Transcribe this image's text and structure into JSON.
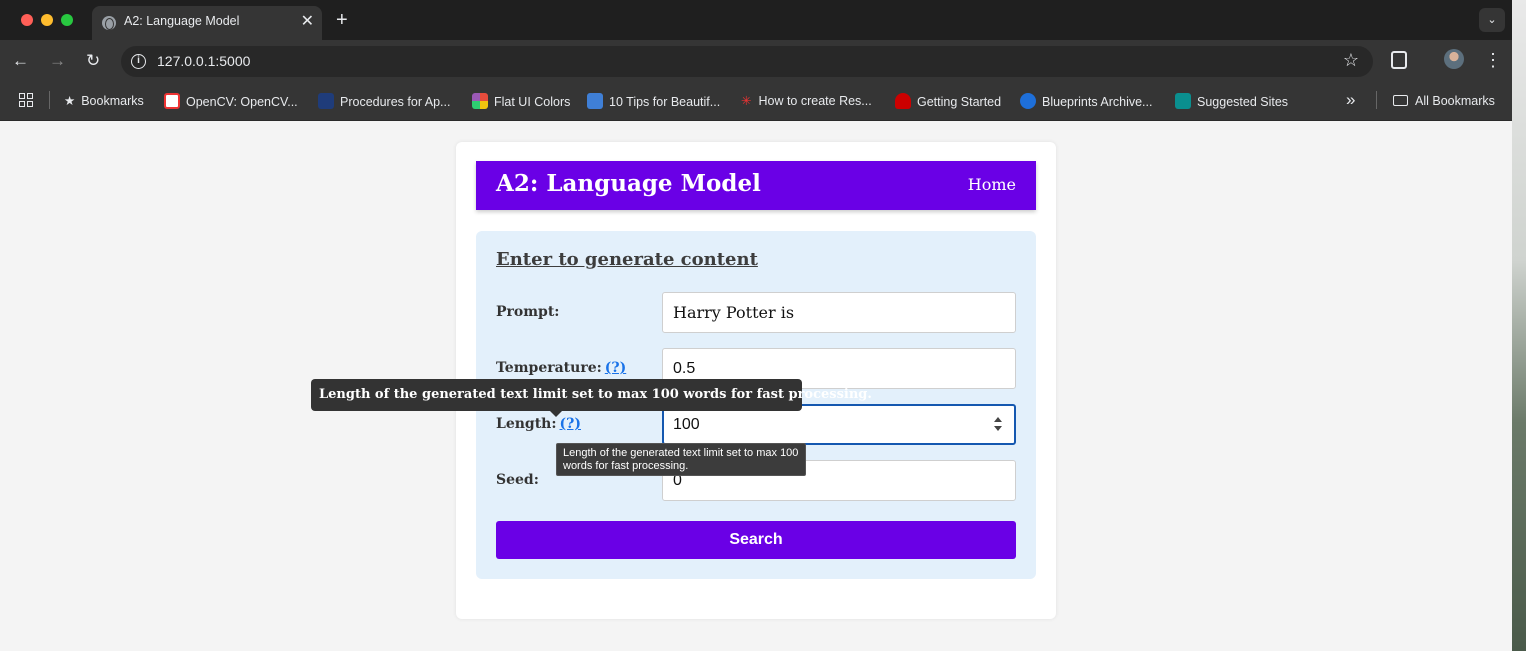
{
  "browser": {
    "tab_title": "A2: Language Model",
    "url": "127.0.0.1:5000",
    "bookmarks": [
      {
        "label": "Bookmarks"
      },
      {
        "label": "OpenCV: OpenCV..."
      },
      {
        "label": "Procedures for Ap..."
      },
      {
        "label": "Flat UI Colors"
      },
      {
        "label": "10 Tips for Beautif..."
      },
      {
        "label": "How to create Res..."
      },
      {
        "label": "Getting Started"
      },
      {
        "label": "Blueprints Archive..."
      },
      {
        "label": "Suggested Sites"
      }
    ],
    "all_bookmarks": "All Bookmarks"
  },
  "header": {
    "title": "A2: Language Model",
    "home": "Home"
  },
  "form": {
    "heading": "Enter to generate content",
    "prompt_label": "Prompt:",
    "prompt_value": "Harry Potter is",
    "temperature_label": "Temperature:",
    "temperature_value": "0.5",
    "length_label": "Length:",
    "length_value": "100",
    "seed_label": "Seed:",
    "seed_value": "0",
    "help_text": "(?)",
    "submit": "Search"
  },
  "tooltips": {
    "length_custom": "Length of the generated text limit set to max 100 words for fast processing.",
    "length_native": "Length of the generated text limit set to max 100 words for fast processing."
  },
  "colors": {
    "accent": "#6a00e6",
    "form_bg": "#e3f0fb",
    "page_bg": "#f4f4f4",
    "link": "#1a73e8"
  }
}
